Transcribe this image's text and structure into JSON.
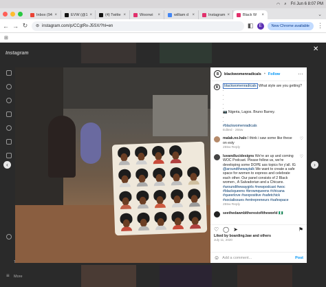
{
  "menubar": {
    "datetime": "Fri Jun 6  8:07 PM"
  },
  "tabs": [
    {
      "label": "Inbox (94",
      "color": "#ea4335",
      "active": false
    },
    {
      "label": "EVW (@1",
      "color": "#111111",
      "active": false
    },
    {
      "label": "(4) Twitte",
      "color": "#111111",
      "active": false
    },
    {
      "label": "Woonwi",
      "color": "#e1306c",
      "active": false
    },
    {
      "label": "william d",
      "color": "#4285f4",
      "active": false
    },
    {
      "label": "Instagram",
      "color": "#e1306c",
      "active": false
    },
    {
      "label": "Black W",
      "color": "#e1306c",
      "active": true
    }
  ],
  "address": {
    "url": "instagram.com/p/CCgtRx-J5SX/?hl=en",
    "profile_initial": "E",
    "chrome_button": "New Chrome available"
  },
  "ig": {
    "logo": "Instagram",
    "sidebar_bottom": [
      "Threads",
      "More"
    ]
  },
  "post": {
    "username": "blackwomenradicals",
    "follow": "Follow",
    "caption_tag": "blackwomenradicals",
    "caption_text": " What style are you getting?",
    "caption_dots": [
      ".",
      ".",
      ".",
      ".",
      "."
    ],
    "location": "📷 Nigeria, Lagos. Bruno Barrey.",
    "caption_dots2": [
      ".",
      "."
    ],
    "hashtag": "#blackwomenradicals",
    "edited": "Edited · 255w",
    "comments": [
      {
        "user": "malak.no.halo",
        "text": " I think i saw some like these on esty",
        "meta": "255w   Reply"
      },
      {
        "user": "luvandlucidesigns",
        "text": " We're an up and coming WOC Podcast. Please follow us, we're developing some DOPE ass topics for y'all. IG ",
        "tag": "@aroundthewaytalk",
        "text2": " We want to create a safe space for women to express and celebrate each other. Our panel consists of 2 Black women , A Salvadorian and a Chicanx. ",
        "hashtags": "#aroundthewaygirls #newpodcast #woc #blackqueens #brownqueens #chicana #queerlove #sexpositive #safetchick #socialissues #entrepreneurs #safespace",
        "meta": "255w   Reply"
      },
      {
        "user": "seethedawnblthe",
        "text": "restofitheworld 🇳🇬",
        "meta": ""
      }
    ],
    "likes": "Liked by boarding.bae and others",
    "date": "July 11, 2020",
    "add_comment": "Add a comment...",
    "post_button": "Post"
  }
}
